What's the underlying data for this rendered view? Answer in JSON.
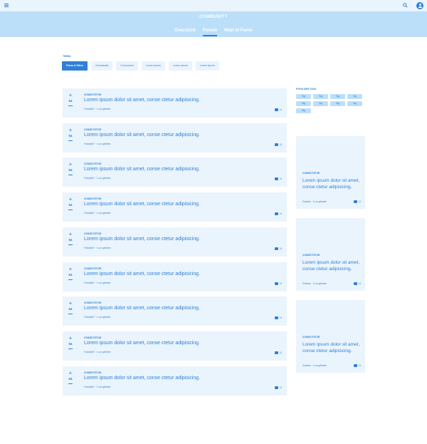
{
  "colors": {
    "accent": "#2f80d6",
    "hero_bg": "#bcdff9",
    "card_bg": "#eaf4fd",
    "topbar_bg": "#e9f4fd"
  },
  "icons": {
    "menu": "hamburger-icon",
    "search": "search-icon",
    "avatar": "user-avatar-icon",
    "comment": "comment-icon"
  },
  "hero": {
    "title": "COMMUNITY",
    "tabs": [
      {
        "label": "Overzicht",
        "active": false
      },
      {
        "label": "Forum",
        "active": true
      },
      {
        "label": "Wall of Fame",
        "active": false
      }
    ]
  },
  "filter": {
    "label": "THEMA",
    "chips": [
      {
        "label": "Fotos & filters",
        "active": true
      },
      {
        "label": "Gesloabaal",
        "active": false
      },
      {
        "label": "Consument",
        "active": false
      },
      {
        "label": "Lorem Ipsum",
        "active": false
      },
      {
        "label": "Lorem Ipsum",
        "active": false
      },
      {
        "label": "Lorem Ipsum",
        "active": false
      }
    ]
  },
  "posts": [
    {
      "votes": "64",
      "category": "CONSECTETUR",
      "title": "Lorem ipsum dolor sit amet, conse ctetur adipisicing.",
      "meta": "Fotoofje07  ·  1 uur geleden",
      "comments": "11"
    },
    {
      "votes": "64",
      "category": "CONSECTETUR",
      "title": "Lorem ipsum dolor sit amet, conse ctetur adipisicing.",
      "meta": "Fotoofje07  ·  1 uur geleden",
      "comments": "11"
    },
    {
      "votes": "64",
      "category": "CONSECTETUR",
      "title": "Lorem ipsum dolor sit amet, conse ctetur adipisicing.",
      "meta": "Fotoofje07  ·  1 uur geleden",
      "comments": "11"
    },
    {
      "votes": "64",
      "category": "CONSECTETUR",
      "title": "Lorem ipsum dolor sit amet, conse ctetur adipisicing.",
      "meta": "Fotoofje07  ·  1 uur geleden",
      "comments": "11"
    },
    {
      "votes": "64",
      "category": "CONSECTETUR",
      "title": "Lorem ipsum dolor sit amet, conse ctetur adipisicing.",
      "meta": "Fotoofje07  ·  1 uur geleden",
      "comments": "11"
    },
    {
      "votes": "64",
      "category": "CONSECTETUR",
      "title": "Lorem ipsum dolor sit amet, conse ctetur adipisicing.",
      "meta": "Fotoofje07  ·  1 uur geleden",
      "comments": "11"
    },
    {
      "votes": "64",
      "category": "CONSECTETUR",
      "title": "Lorem ipsum dolor sit amet, conse ctetur adipisicing.",
      "meta": "Fotoofje07  ·  1 uur geleden",
      "comments": "11"
    },
    {
      "votes": "64",
      "category": "CONSECTETUR",
      "title": "Lorem ipsum dolor sit amet, conse ctetur adipisicing.",
      "meta": "Fotoofje07  ·  1 uur geleden",
      "comments": "11"
    },
    {
      "votes": "64",
      "category": "CONSECTETUR",
      "title": "Lorem ipsum dolor sit amet, conse ctetur adipisicing.",
      "meta": "Fotoofje07  ·  1 uur geleden",
      "comments": "11"
    }
  ],
  "popular_tags": {
    "label": "POPULAIRE TAGS",
    "tags": [
      "Tag",
      "Tag",
      "Tag",
      "Tag",
      "Tag",
      "Tag",
      "Tag",
      "Tag",
      "Tag"
    ]
  },
  "side_cards": [
    {
      "category": "CONSECTETUR",
      "title": "Lorem ipsum dolor sit amet, conse ctetur adipisicing.",
      "meta": "Zomfoto  ·  1 uur geleden",
      "comments": "11"
    },
    {
      "category": "CONSECTETUR",
      "title": "Lorem ipsum dolor sit amet, conse ctetur adipisicing.",
      "meta": "Zomfoto  ·  1 uur geleden",
      "comments": "11"
    },
    {
      "category": "CONSECTETUR",
      "title": "Lorem ipsum dolor sit amet, conse ctetur adipisicing.",
      "meta": "Zomfoto  ·  1 uur geleden",
      "comments": "11"
    }
  ]
}
